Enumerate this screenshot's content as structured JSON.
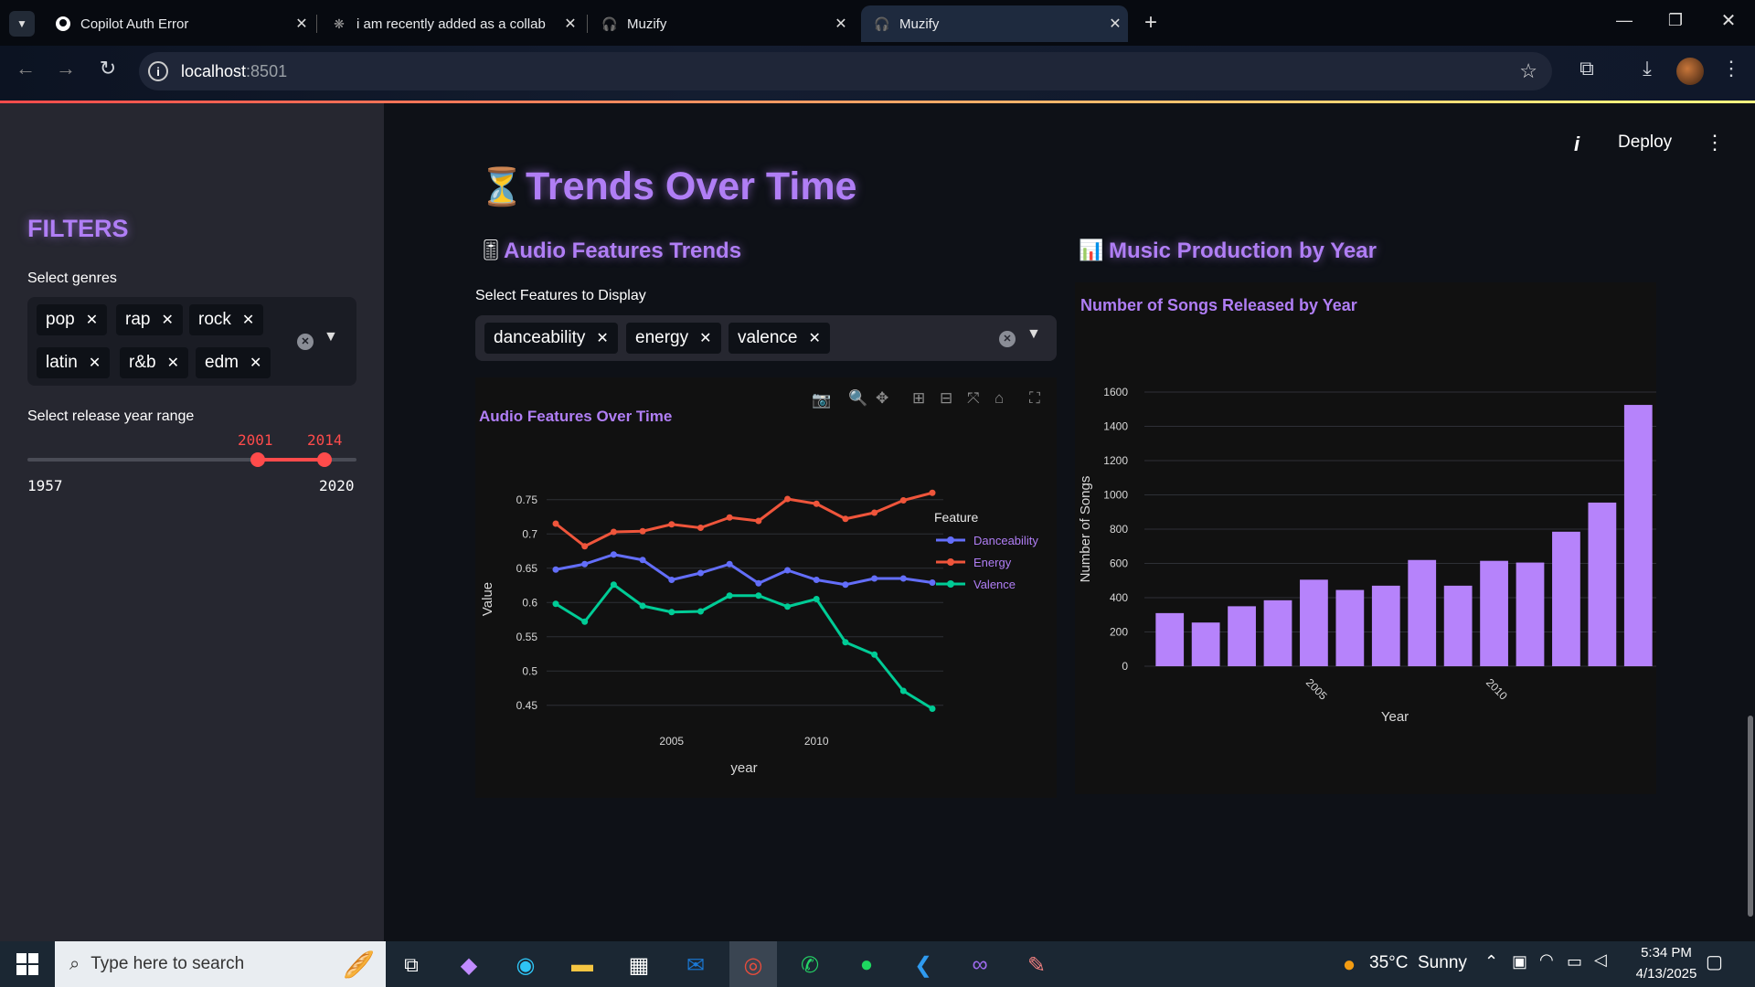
{
  "browser": {
    "tabs": [
      {
        "title": "Copilot Auth Error",
        "icon": "github-icon"
      },
      {
        "title": "i am recently added as a collab",
        "icon": "loading-icon"
      },
      {
        "title": "Muzify",
        "icon": "headphones-icon"
      },
      {
        "title": "Muzify",
        "icon": "headphones-icon",
        "active": true
      }
    ],
    "url_host": "localhost",
    "url_port": ":8501"
  },
  "app_header": {
    "deploy_label": "Deploy"
  },
  "sidebar": {
    "title": "FILTERS",
    "genres_label": "Select genres",
    "genres": [
      "pop",
      "rap",
      "rock",
      "latin",
      "r&b",
      "edm"
    ],
    "year_label": "Select release year range",
    "year_selected_min": "2001",
    "year_selected_max": "2014",
    "year_min": "1957",
    "year_max": "2020"
  },
  "main": {
    "page_title": "Trends Over Time",
    "left_section_title": "Audio Features Trends",
    "features_label": "Select Features to Display",
    "features": [
      "danceability",
      "energy",
      "valence"
    ],
    "right_section_title": "Music Production by Year"
  },
  "chart_data": [
    {
      "type": "line",
      "title": "Audio Features Over Time",
      "xlabel": "year",
      "ylabel": "Value",
      "legend_title": "Feature",
      "legend_position": "top-right",
      "x": [
        2001,
        2002,
        2003,
        2004,
        2005,
        2006,
        2007,
        2008,
        2009,
        2010,
        2011,
        2012,
        2013,
        2014
      ],
      "x_ticks": [
        "2005",
        "2010"
      ],
      "y_ticks": [
        "0.45",
        "0.5",
        "0.55",
        "0.6",
        "0.65",
        "0.7",
        "0.75"
      ],
      "ylim": [
        0.435,
        0.775
      ],
      "series": [
        {
          "name": "Danceability",
          "color": "#636efa",
          "values": [
            0.648,
            0.656,
            0.67,
            0.662,
            0.633,
            0.643,
            0.656,
            0.628,
            0.647,
            0.633,
            0.626,
            0.635,
            0.635,
            0.629
          ]
        },
        {
          "name": "Energy",
          "color": "#ef553b",
          "values": [
            0.715,
            0.682,
            0.703,
            0.704,
            0.714,
            0.709,
            0.724,
            0.719,
            0.751,
            0.744,
            0.722,
            0.731,
            0.749,
            0.76
          ]
        },
        {
          "name": "Valence",
          "color": "#00cc96",
          "values": [
            0.598,
            0.572,
            0.626,
            0.595,
            0.586,
            0.587,
            0.61,
            0.61,
            0.594,
            0.605,
            0.542,
            0.524,
            0.471,
            0.445
          ]
        }
      ]
    },
    {
      "type": "bar",
      "title": "Number of Songs Released by Year",
      "xlabel": "Year",
      "ylabel": "Number of Songs",
      "color": "#b683fb",
      "x": [
        2001,
        2002,
        2003,
        2004,
        2005,
        2006,
        2007,
        2008,
        2009,
        2010,
        2011,
        2012,
        2013,
        2014
      ],
      "values": [
        310,
        255,
        350,
        385,
        505,
        445,
        470,
        620,
        470,
        615,
        605,
        785,
        955,
        1525
      ],
      "x_ticks": [
        "2005",
        "2010"
      ],
      "y_ticks": [
        "0",
        "200",
        "400",
        "600",
        "800",
        "1000",
        "1200",
        "1400",
        "1600"
      ],
      "ylim": [
        0,
        1600
      ]
    }
  ],
  "taskbar": {
    "search_placeholder": "Type here to search",
    "weather": "35°C  Sunny",
    "time": "5:34 PM",
    "date": "4/13/2025"
  }
}
